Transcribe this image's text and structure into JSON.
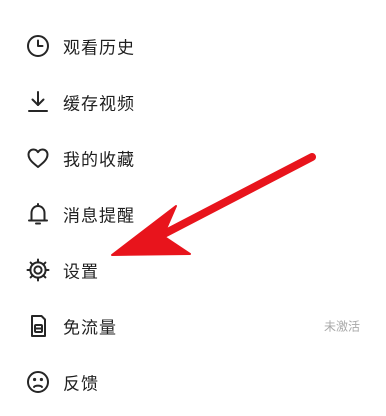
{
  "menu": {
    "items": [
      {
        "label": "观看历史",
        "icon": "clock-icon"
      },
      {
        "label": "缓存视频",
        "icon": "download-icon"
      },
      {
        "label": "我的收藏",
        "icon": "heart-icon"
      },
      {
        "label": "消息提醒",
        "icon": "bell-icon"
      },
      {
        "label": "设置",
        "icon": "gear-icon"
      },
      {
        "label": "免流量",
        "icon": "sim-card-icon",
        "status": "未激活"
      },
      {
        "label": "反馈",
        "icon": "sad-face-icon"
      }
    ]
  },
  "annotation": {
    "arrow_color": "#e8141c",
    "points_to": "设置"
  },
  "colors": {
    "text": "#1f1f1f",
    "icon": "#262626",
    "muted": "#a8a8a8",
    "background": "#ffffff"
  }
}
